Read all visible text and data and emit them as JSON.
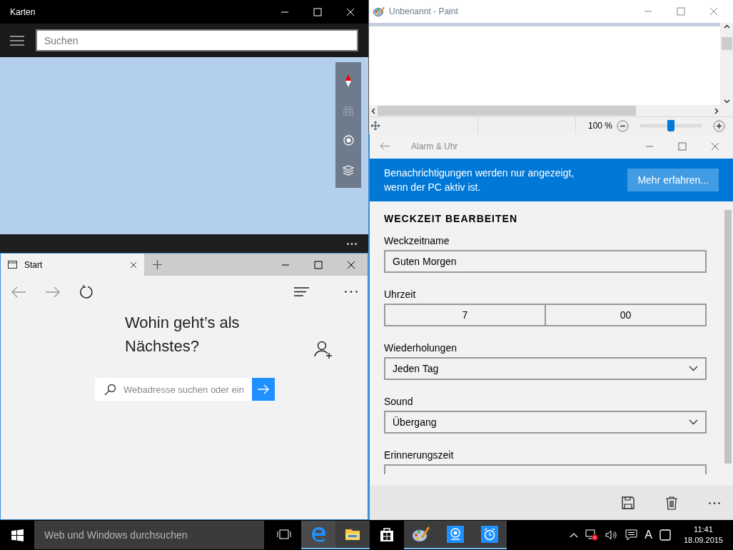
{
  "maps": {
    "title": "Karten",
    "search_placeholder": "Suchen"
  },
  "paint": {
    "title": "Unbenannt - Paint",
    "zoom": "100 %",
    "zoom_slider": {
      "level": 0.5
    }
  },
  "edge": {
    "tab": "Start",
    "heading": "Wohin geht’s als Nächstes?",
    "search_placeholder": "Webadresse suchen oder ein"
  },
  "alarm": {
    "title": "Alarm & Uhr",
    "banner": {
      "text": "Benachrichtigungen werden nur angezeigt, wenn der PC aktiv ist.",
      "button": "Mehr erfahren..."
    },
    "heading": "WECKZEIT BEARBEITEN",
    "fields": [
      {
        "kind": "text",
        "label": "Weckzeitname",
        "value": "Guten Morgen"
      },
      {
        "kind": "time",
        "label": "Uhrzeit",
        "hours": "7",
        "minutes": "00"
      },
      {
        "kind": "select",
        "label": "Wiederholungen",
        "value": "Jeden Tag"
      },
      {
        "kind": "select",
        "label": "Sound",
        "value": "Übergang"
      },
      {
        "kind": "cut",
        "label": "Erinnerungszeit"
      }
    ]
  },
  "taskbar": {
    "search_placeholder": "Web und Windows durchsuchen",
    "apps": [
      {
        "kind": "taskview",
        "active": false
      },
      {
        "kind": "edge",
        "active": true
      },
      {
        "kind": "explorer",
        "active": true
      },
      {
        "kind": "store",
        "active": false
      },
      {
        "kind": "paint",
        "active": true
      },
      {
        "kind": "camera",
        "active": true
      },
      {
        "kind": "alarm",
        "active": true
      }
    ],
    "input_indicator": "A",
    "time": "11:41",
    "date": "18.09.2015"
  }
}
